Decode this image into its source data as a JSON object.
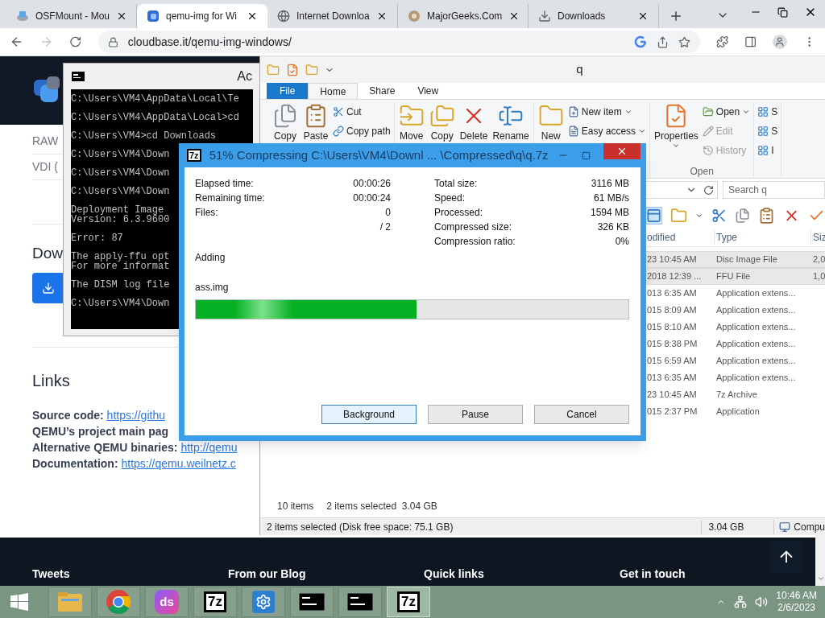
{
  "browser": {
    "tabs": [
      {
        "title": "OSFMount - Mou",
        "selected": false
      },
      {
        "title": "qemu-img for Wi",
        "selected": true
      },
      {
        "title": "Internet Downloa",
        "selected": false
      },
      {
        "title": "MajorGeeks.Com",
        "selected": false
      },
      {
        "title": "Downloads",
        "selected": false
      }
    ],
    "address": {
      "url": "cloudbase.it/qemu-img-windows/",
      "forward_enabled": false
    },
    "page": {
      "formats": [
        "RAW",
        "VDI ("
      ],
      "download_heading": "Dow",
      "links_heading": "Links",
      "links": [
        {
          "label": "Source code:",
          "url": "https://githu"
        },
        {
          "label": "QEMU’s project main pag"
        },
        {
          "label": "Alternative QEMU binaries:",
          "url": "http://qemu"
        },
        {
          "label": "Documentation:",
          "url": "https://qemu.weilnetz.c"
        }
      ],
      "footer": [
        "Tweets",
        "From our Blog",
        "Quick links",
        "Get in touch"
      ]
    }
  },
  "console": {
    "title": "Ac",
    "blocks": [
      [
        "C:\\Users\\VM4\\AppData\\Local\\Te"
      ],
      [
        "C:\\Users\\VM4\\AppData\\Local>cd"
      ],
      [
        "C:\\Users\\VM4>cd Downloads"
      ],
      [
        "C:\\Users\\VM4\\Down"
      ],
      [
        "C:\\Users\\VM4\\Down"
      ],
      [
        "C:\\Users\\VM4\\Down"
      ],
      [
        "Deployment Image",
        "Version: 6.3.9600"
      ],
      [
        "Error: 87"
      ],
      [
        "The apply-ffu opt",
        "For more informat"
      ],
      [
        "The DISM log file"
      ],
      [
        "C:\\Users\\VM4\\Down"
      ]
    ]
  },
  "explorer": {
    "title": "q",
    "tabs": [
      {
        "label": "File",
        "kind": "file",
        "selected": false
      },
      {
        "label": "Home",
        "kind": "tab",
        "selected": true
      },
      {
        "label": "Share",
        "kind": "tab",
        "selected": false
      },
      {
        "label": "View",
        "kind": "tab",
        "selected": false
      }
    ],
    "groups": [
      {
        "items": [
          {
            "kind": "large",
            "label": "Copy",
            "dropdown": false,
            "disabled": false
          },
          {
            "kind": "large",
            "label": "Paste",
            "dropdown": false,
            "disabled": false
          },
          {
            "kind": "small",
            "label": "Cut",
            "dropdown": false,
            "disabled": false
          },
          {
            "kind": "small",
            "label": "Copy path",
            "dropdown": false,
            "disabled": false
          }
        ]
      },
      {
        "items": [
          {
            "kind": "large",
            "label": "Move",
            "dropdown": false,
            "disabled": false
          },
          {
            "kind": "large",
            "label": "Copy",
            "dropdown": false,
            "disabled": false
          },
          {
            "kind": "large",
            "label": "Delete",
            "dropdown": false,
            "disabled": false
          },
          {
            "kind": "large",
            "label": "Rename",
            "dropdown": false,
            "disabled": false
          }
        ]
      },
      {
        "items": [
          {
            "kind": "large",
            "label": "New",
            "dropdown": false,
            "disabled": false
          },
          {
            "kind": "small",
            "label": "New item",
            "dropdown": true,
            "disabled": false
          },
          {
            "kind": "small",
            "label": "Easy access",
            "dropdown": true,
            "disabled": false
          }
        ]
      },
      {
        "label": "Open",
        "items": [
          {
            "kind": "large",
            "label": "Properties",
            "dropdown": true,
            "disabled": false
          },
          {
            "kind": "small",
            "label": "Open",
            "dropdown": true,
            "disabled": false
          },
          {
            "kind": "small",
            "label": "Edit",
            "dropdown": false,
            "disabled": true
          },
          {
            "kind": "small",
            "label": "History",
            "dropdown": false,
            "disabled": true
          }
        ]
      },
      {
        "items": [
          {
            "kind": "small",
            "label": "S",
            "dropdown": false,
            "disabled": false
          },
          {
            "kind": "small",
            "label": "S",
            "dropdown": false,
            "disabled": false
          },
          {
            "kind": "small",
            "label": "I",
            "dropdown": false,
            "disabled": false
          }
        ]
      }
    ],
    "search": {
      "placeholder": "Search q"
    },
    "columns": [
      "odified",
      "Type",
      "Siz"
    ],
    "rows": [
      {
        "modified": "23 10:45 AM",
        "type": "Disc Image File",
        "size": "2,0",
        "selected": true
      },
      {
        "modified": "2018 12:39 ...",
        "type": "FFU File",
        "size": "1,0",
        "selected": true
      },
      {
        "modified": "013 6:35 AM",
        "type": "Application extens...",
        "selected": false
      },
      {
        "modified": "015 8:09 AM",
        "type": "Application extens...",
        "selected": false
      },
      {
        "modified": "015 8:10 AM",
        "type": "Application extens...",
        "selected": false
      },
      {
        "modified": "015 8:38 PM",
        "type": "Application extens...",
        "selected": false
      },
      {
        "modified": "015 6:59 AM",
        "type": "Application extens...",
        "selected": false
      },
      {
        "modified": "013 6:35 AM",
        "type": "Application extens...",
        "selected": false
      },
      {
        "modified": "23 10:45 AM",
        "type": "7z Archive",
        "selected": false
      },
      {
        "modified": "015 2:37 PM",
        "type": "Application",
        "selected": false
      }
    ],
    "item_count": "10 items",
    "selection": "2 items selected  3.04 GB",
    "status_bar": {
      "text": "2 items selected (Disk free space: 75.1 GB)",
      "size": "3.04 GB",
      "location": "Compu"
    }
  },
  "dialog": {
    "icon_text": "7z",
    "title": "51% Compressing C:\\Users\\VM4\\Downl ... \\Compressed\\q\\q.7z",
    "stats_left": [
      {
        "label": "Elapsed time:",
        "value": "00:00:26"
      },
      {
        "label": "Remaining time:",
        "value": "00:00:24"
      },
      {
        "label": "Files:",
        "value": "0"
      },
      {
        "value": "/ 2"
      }
    ],
    "stats_right": [
      {
        "label": "Total size:",
        "value": "3116 MB"
      },
      {
        "label": "Speed:",
        "value": "61 MB/s"
      },
      {
        "label": "Processed:",
        "value": "1594 MB"
      },
      {
        "label": "Compressed size:",
        "value": "326 KB"
      },
      {
        "label": "Compression ratio:",
        "value": "0%"
      }
    ],
    "action": "Adding",
    "file": "ass.img",
    "level": 0.51,
    "buttons": [
      {
        "label": "Background",
        "focused": true
      },
      {
        "label": "Pause",
        "focused": false
      },
      {
        "label": "Cancel",
        "focused": false
      }
    ]
  },
  "taskbar": {
    "items": [
      {
        "kind": "explorer",
        "selected": false
      },
      {
        "kind": "chrome",
        "selected": false
      },
      {
        "kind": "ds",
        "glyph": "ds",
        "selected": false
      },
      {
        "kind": "sevenzip",
        "glyph": "7z",
        "selected": false
      },
      {
        "kind": "settings",
        "selected": false
      },
      {
        "kind": "console",
        "selected": false
      },
      {
        "kind": "console",
        "selected": false
      },
      {
        "kind": "sevenzip",
        "glyph": "7z",
        "selected": true
      }
    ],
    "time": "10:46 AM",
    "date": "2/6/2023"
  }
}
